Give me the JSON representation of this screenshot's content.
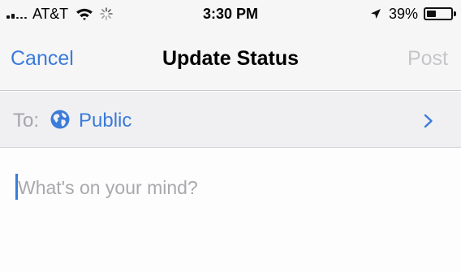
{
  "status_bar": {
    "carrier": "AT&T",
    "time": "3:30 PM",
    "battery_percent": "39%",
    "battery_level": 0.39,
    "icons": [
      "signal-icon",
      "wifi-icon",
      "activity-spinner-icon",
      "location-arrow-icon",
      "battery-icon"
    ]
  },
  "nav": {
    "cancel_label": "Cancel",
    "title": "Update Status",
    "post_label": "Post"
  },
  "audience": {
    "label": "To:",
    "value": "Public",
    "icons": [
      "globe-icon",
      "chevron-right-icon"
    ]
  },
  "composer": {
    "placeholder": "What's on your mind?"
  },
  "colors": {
    "accent": "#3b7bd9",
    "disabled": "#c6c6c9",
    "placeholder": "#a9a9ad",
    "bar_background": "#f6f6f7"
  }
}
